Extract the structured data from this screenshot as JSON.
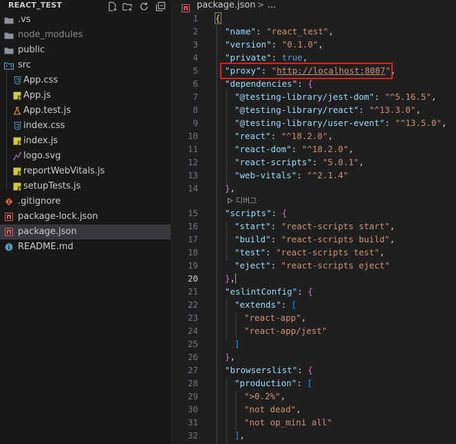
{
  "explorer": {
    "title": "REACT_TEST",
    "actions": [
      "new-file-icon",
      "new-folder-icon",
      "refresh-icon",
      "collapse-all-icon"
    ],
    "items": [
      {
        "label": "> .vs",
        "display": ".vs",
        "type": "folder",
        "icon": "folder-icon",
        "depth": 0,
        "dim": false
      },
      {
        "label": "node_modules",
        "type": "folder",
        "icon": "folder-icon",
        "depth": 0,
        "dim": true
      },
      {
        "label": "public",
        "type": "folder",
        "icon": "folder-icon",
        "depth": 0,
        "dim": false
      },
      {
        "label": "src",
        "type": "folder",
        "icon": "src-folder-icon",
        "depth": 0,
        "dim": false
      },
      {
        "label": "App.css",
        "type": "file",
        "icon": "css-icon",
        "depth": 1,
        "dim": false
      },
      {
        "label": "App.js",
        "type": "file",
        "icon": "js-icon",
        "depth": 1,
        "dim": false
      },
      {
        "label": "App.test.js",
        "type": "file",
        "icon": "test-js-icon",
        "depth": 1,
        "dim": false
      },
      {
        "label": "index.css",
        "type": "file",
        "icon": "css-icon",
        "depth": 1,
        "dim": false
      },
      {
        "label": "index.js",
        "type": "file",
        "icon": "js-icon",
        "depth": 1,
        "dim": false
      },
      {
        "label": "logo.svg",
        "type": "file",
        "icon": "svg-icon",
        "depth": 1,
        "dim": false
      },
      {
        "label": "reportWebVitals.js",
        "type": "file",
        "icon": "js-icon",
        "depth": 1,
        "dim": false
      },
      {
        "label": "setupTests.js",
        "type": "file",
        "icon": "js-icon",
        "depth": 1,
        "dim": false
      },
      {
        "label": ".gitignore",
        "type": "file",
        "icon": "git-icon",
        "depth": 0,
        "dim": false
      },
      {
        "label": "package-lock.json",
        "type": "file",
        "icon": "npm-lock-icon",
        "depth": 0,
        "dim": false
      },
      {
        "label": "package.json",
        "type": "file",
        "icon": "npm-icon",
        "depth": 0,
        "dim": false,
        "selected": true
      },
      {
        "label": "README.md",
        "type": "file",
        "icon": "info-icon",
        "depth": 0,
        "dim": false
      }
    ]
  },
  "breadcrumb": {
    "file": "package.json",
    "separator": ">",
    "more": "..."
  },
  "editor": {
    "active_line": 20,
    "codelens_after_line": 14,
    "codelens_text": "디버그",
    "highlight_line": 5,
    "lines": [
      {
        "n": 1,
        "indent": 0,
        "tokens": [
          [
            "{",
            "b1"
          ]
        ]
      },
      {
        "n": 2,
        "indent": 1,
        "tokens": [
          [
            "\"name\"",
            "key"
          ],
          [
            ": ",
            "punc"
          ],
          [
            "\"react_test\"",
            "str"
          ],
          [
            ",",
            "punc"
          ]
        ]
      },
      {
        "n": 3,
        "indent": 1,
        "tokens": [
          [
            "\"version\"",
            "key"
          ],
          [
            ": ",
            "punc"
          ],
          [
            "\"0.1.0\"",
            "str"
          ],
          [
            ",",
            "punc"
          ]
        ]
      },
      {
        "n": 4,
        "indent": 1,
        "tokens": [
          [
            "\"private\"",
            "key"
          ],
          [
            ": ",
            "punc"
          ],
          [
            "true",
            "kw"
          ],
          [
            ",",
            "punc"
          ]
        ]
      },
      {
        "n": 5,
        "indent": 1,
        "tokens": [
          [
            "\"proxy\"",
            "key"
          ],
          [
            ": ",
            "punc"
          ],
          [
            "\"",
            "str"
          ],
          [
            "http://localhost:8087",
            "url"
          ],
          [
            "\"",
            "str"
          ],
          [
            ",",
            "punc"
          ]
        ]
      },
      {
        "n": 6,
        "indent": 1,
        "tokens": [
          [
            "\"dependencies\"",
            "key"
          ],
          [
            ": ",
            "punc"
          ],
          [
            "{",
            "b2"
          ]
        ]
      },
      {
        "n": 7,
        "indent": 2,
        "tokens": [
          [
            "\"@testing-library/jest-dom\"",
            "key"
          ],
          [
            ": ",
            "punc"
          ],
          [
            "\"^5.16.5\"",
            "str"
          ],
          [
            ",",
            "punc"
          ]
        ]
      },
      {
        "n": 8,
        "indent": 2,
        "tokens": [
          [
            "\"@testing-library/react\"",
            "key"
          ],
          [
            ": ",
            "punc"
          ],
          [
            "\"^13.3.0\"",
            "str"
          ],
          [
            ",",
            "punc"
          ]
        ]
      },
      {
        "n": 9,
        "indent": 2,
        "tokens": [
          [
            "\"@testing-library/user-event\"",
            "key"
          ],
          [
            ": ",
            "punc"
          ],
          [
            "\"^13.5.0\"",
            "str"
          ],
          [
            ",",
            "punc"
          ]
        ]
      },
      {
        "n": 10,
        "indent": 2,
        "tokens": [
          [
            "\"react\"",
            "key"
          ],
          [
            ": ",
            "punc"
          ],
          [
            "\"^18.2.0\"",
            "str"
          ],
          [
            ",",
            "punc"
          ]
        ]
      },
      {
        "n": 11,
        "indent": 2,
        "tokens": [
          [
            "\"react-dom\"",
            "key"
          ],
          [
            ": ",
            "punc"
          ],
          [
            "\"^18.2.0\"",
            "str"
          ],
          [
            ",",
            "punc"
          ]
        ]
      },
      {
        "n": 12,
        "indent": 2,
        "tokens": [
          [
            "\"react-scripts\"",
            "key"
          ],
          [
            ": ",
            "punc"
          ],
          [
            "\"5.0.1\"",
            "str"
          ],
          [
            ",",
            "punc"
          ]
        ]
      },
      {
        "n": 13,
        "indent": 2,
        "tokens": [
          [
            "\"web-vitals\"",
            "key"
          ],
          [
            ": ",
            "punc"
          ],
          [
            "\"^2.1.4\"",
            "str"
          ]
        ]
      },
      {
        "n": 14,
        "indent": 1,
        "tokens": [
          [
            "}",
            "b2"
          ],
          [
            ",",
            "punc"
          ]
        ]
      },
      {
        "n": 15,
        "indent": 1,
        "tokens": [
          [
            "\"scripts\"",
            "key"
          ],
          [
            ": ",
            "punc"
          ],
          [
            "{",
            "b2"
          ]
        ]
      },
      {
        "n": 16,
        "indent": 2,
        "tokens": [
          [
            "\"start\"",
            "key"
          ],
          [
            ": ",
            "punc"
          ],
          [
            "\"react-scripts start\"",
            "str"
          ],
          [
            ",",
            "punc"
          ]
        ]
      },
      {
        "n": 17,
        "indent": 2,
        "tokens": [
          [
            "\"build\"",
            "key"
          ],
          [
            ": ",
            "punc"
          ],
          [
            "\"react-scripts build\"",
            "str"
          ],
          [
            ",",
            "punc"
          ]
        ]
      },
      {
        "n": 18,
        "indent": 2,
        "tokens": [
          [
            "\"test\"",
            "key"
          ],
          [
            ": ",
            "punc"
          ],
          [
            "\"react-scripts test\"",
            "str"
          ],
          [
            ",",
            "punc"
          ]
        ]
      },
      {
        "n": 19,
        "indent": 2,
        "tokens": [
          [
            "\"eject\"",
            "key"
          ],
          [
            ": ",
            "punc"
          ],
          [
            "\"react-scripts eject\"",
            "str"
          ]
        ]
      },
      {
        "n": 20,
        "indent": 1,
        "tokens": [
          [
            "}",
            "b2"
          ],
          [
            ",",
            "punc"
          ]
        ]
      },
      {
        "n": 21,
        "indent": 1,
        "tokens": [
          [
            "\"eslintConfig\"",
            "key"
          ],
          [
            ": ",
            "punc"
          ],
          [
            "{",
            "b2"
          ]
        ]
      },
      {
        "n": 22,
        "indent": 2,
        "tokens": [
          [
            "\"extends\"",
            "key"
          ],
          [
            ": ",
            "punc"
          ],
          [
            "[",
            "b3"
          ]
        ]
      },
      {
        "n": 23,
        "indent": 3,
        "tokens": [
          [
            "\"react-app\"",
            "str"
          ],
          [
            ",",
            "punc"
          ]
        ]
      },
      {
        "n": 24,
        "indent": 3,
        "tokens": [
          [
            "\"react-app/jest\"",
            "str"
          ]
        ]
      },
      {
        "n": 25,
        "indent": 2,
        "tokens": [
          [
            "]",
            "b3"
          ]
        ]
      },
      {
        "n": 26,
        "indent": 1,
        "tokens": [
          [
            "}",
            "b2"
          ],
          [
            ",",
            "punc"
          ]
        ]
      },
      {
        "n": 27,
        "indent": 1,
        "tokens": [
          [
            "\"browserslist\"",
            "key"
          ],
          [
            ": ",
            "punc"
          ],
          [
            "{",
            "b2"
          ]
        ]
      },
      {
        "n": 28,
        "indent": 2,
        "tokens": [
          [
            "\"production\"",
            "key"
          ],
          [
            ": ",
            "punc"
          ],
          [
            "[",
            "b3"
          ]
        ]
      },
      {
        "n": 29,
        "indent": 3,
        "tokens": [
          [
            "\">0.2%\"",
            "str"
          ],
          [
            ",",
            "punc"
          ]
        ]
      },
      {
        "n": 30,
        "indent": 3,
        "tokens": [
          [
            "\"not dead\"",
            "str"
          ],
          [
            ",",
            "punc"
          ]
        ]
      },
      {
        "n": 31,
        "indent": 3,
        "tokens": [
          [
            "\"not op_mini all\"",
            "str"
          ]
        ]
      },
      {
        "n": 32,
        "indent": 2,
        "tokens": [
          [
            "]",
            "b3"
          ],
          [
            ",",
            "punc"
          ]
        ]
      }
    ]
  },
  "colors": {
    "sidebar_bg": "#181818",
    "editor_bg": "#1f1f1f",
    "selection_bg": "#37373d",
    "highlight_box": "#e02020",
    "json_key": "#9cdcfe",
    "json_string": "#ce9178",
    "json_keyword": "#569cd6"
  }
}
